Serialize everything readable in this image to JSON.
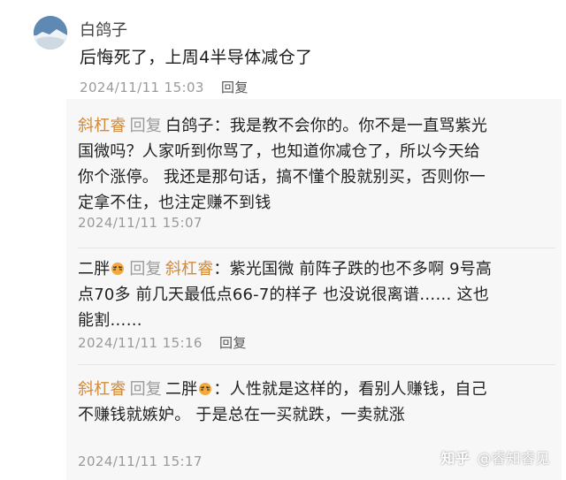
{
  "post": {
    "author": "白鸽子",
    "text": "后悔死了，上周4半导体减仓了",
    "time": "2024/11/11 15:03",
    "reply_label": "回复"
  },
  "replies": [
    {
      "from": "斜杠睿",
      "reply_word": "回复",
      "to": "白鸽子",
      "body": "：我是教不会你的。你不是一直骂紫光国微吗？人家听到你骂了，也知道你减仓了，所以今天给你个涨停。 我还是那句话，搞不懂个股就别买，否则你一定拿不住，也注定赚不到钱",
      "time": "2024/11/11 15:07"
    },
    {
      "from": "二胖",
      "reply_word": "回复",
      "to": "斜杠睿",
      "body": "：紫光国微 前阵子跌的也不多啊 9号高点70多 前几天最低点66-7的样子 也没说很离谱…… 这也能割……",
      "time": "2024/11/11 15:16",
      "reply_label": "回复"
    },
    {
      "from": "斜杠睿",
      "reply_word": "回复",
      "to": "二胖",
      "body": "：人性就是这样的，看别人赚钱，自己不赚钱就嫉妒。 于是总在一买就跌，一卖就涨",
      "time": "2024/11/11 15:17"
    }
  ],
  "watermark": {
    "logo": "知乎",
    "handle": "@睿知睿见"
  },
  "colors": {
    "name_link": "#d18b3c",
    "meta_gray": "#9a9a9a",
    "thread_bg": "#f7f7f8"
  }
}
